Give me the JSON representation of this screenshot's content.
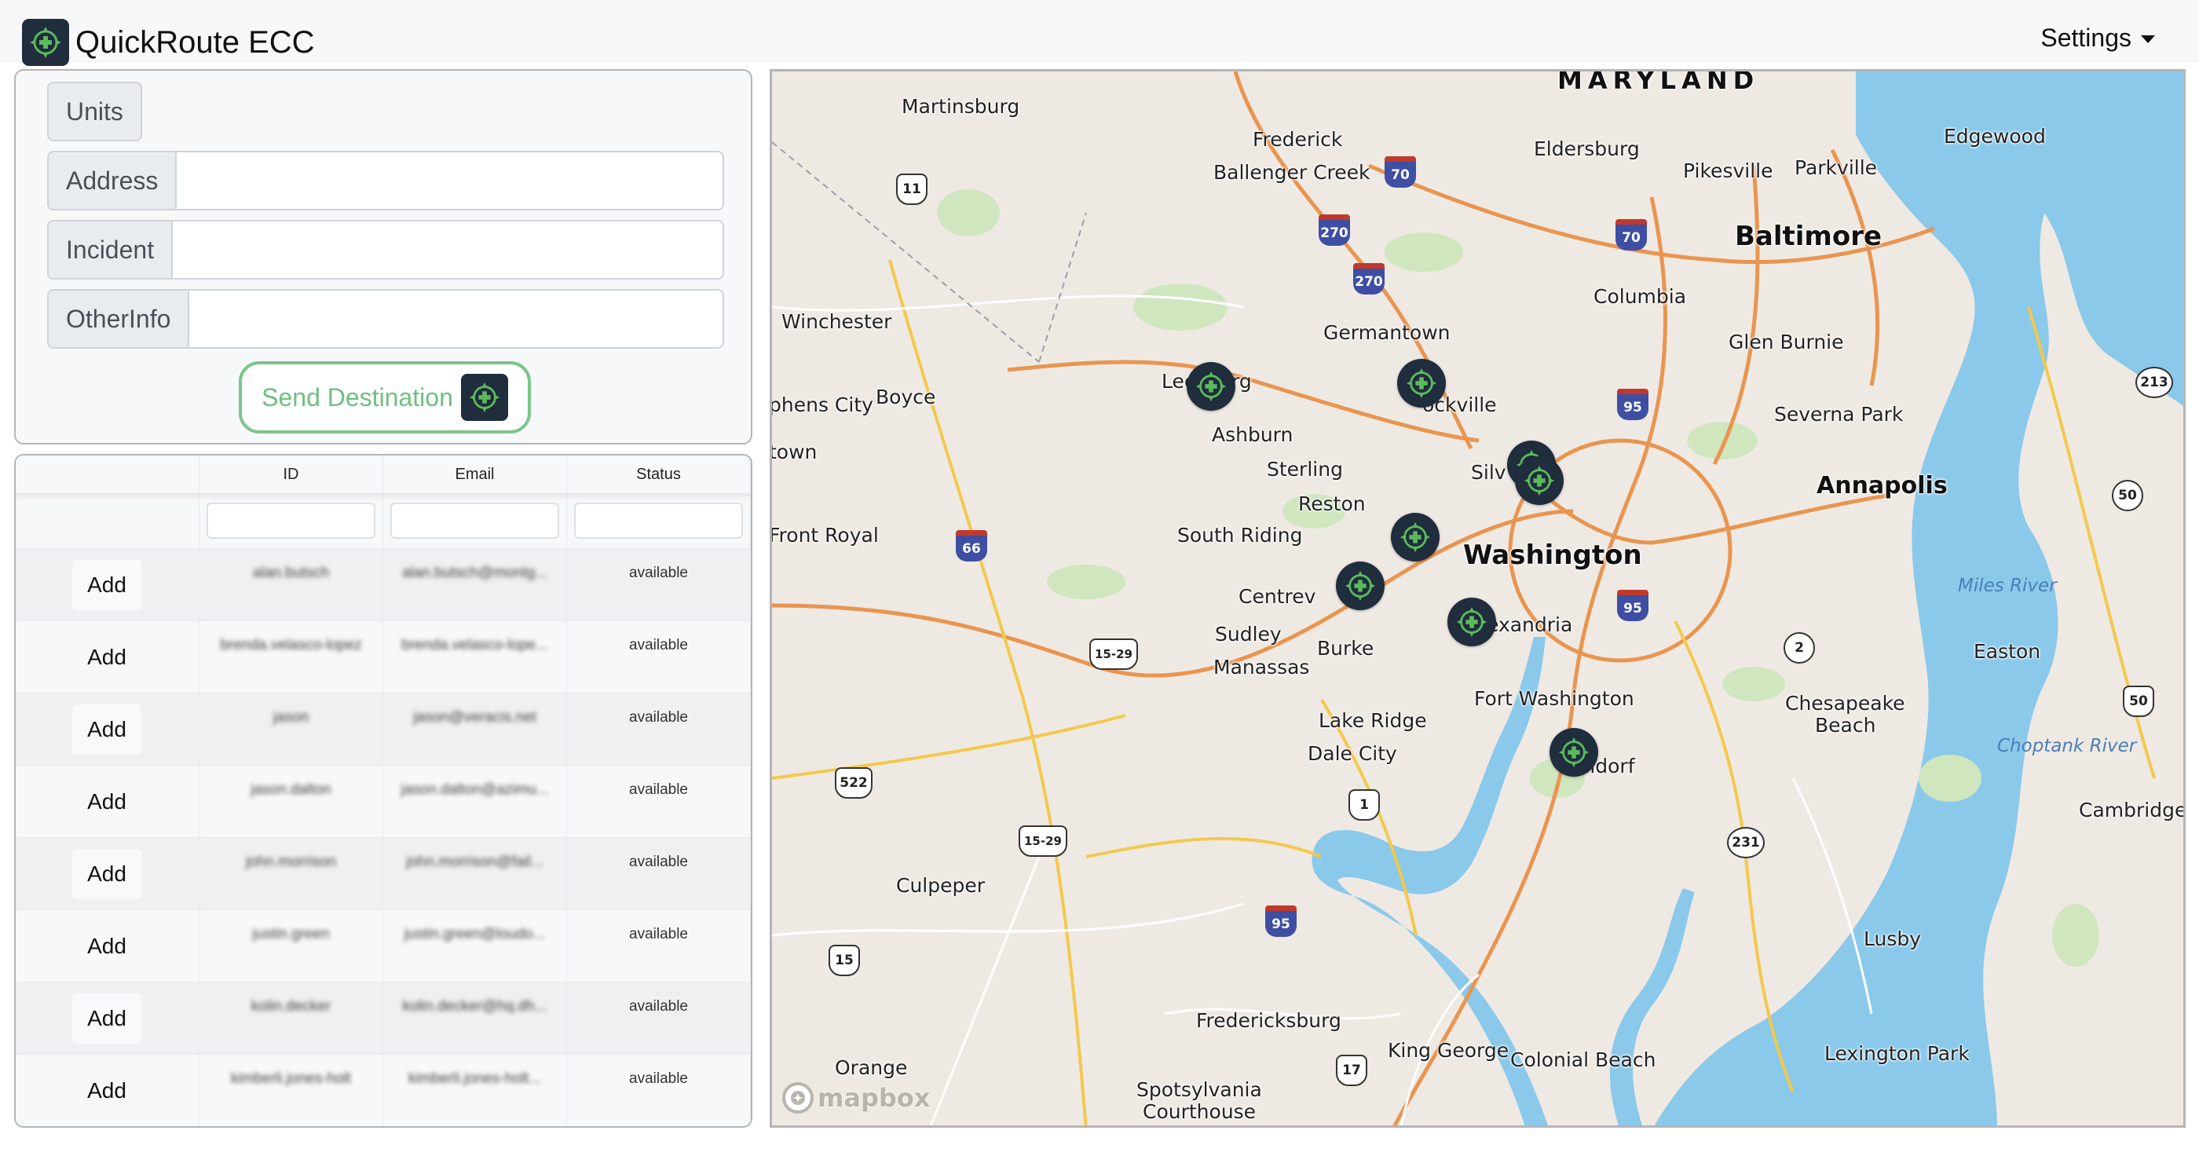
{
  "header": {
    "title": "QuickRoute ECC",
    "settings_label": "Settings"
  },
  "form": {
    "units_label": "Units",
    "address_label": "Address",
    "address_value": "",
    "incident_label": "Incident",
    "incident_value": "",
    "otherinfo_label": "OtherInfo",
    "otherinfo_value": "",
    "send_button_label": "Send Destination"
  },
  "table": {
    "columns": [
      "",
      "ID",
      "Email",
      "Status"
    ],
    "add_label": "Add",
    "rows": [
      {
        "id": "alan.butsch",
        "email": "alan.butsch@montg...",
        "status": "available"
      },
      {
        "id": "brenda.velasco-lopez",
        "email": "brenda.velasco-lope...",
        "status": "available"
      },
      {
        "id": "jason",
        "email": "jason@veracis.net",
        "status": "available"
      },
      {
        "id": "jason.dalton",
        "email": "jason.dalton@azimu...",
        "status": "available"
      },
      {
        "id": "john.morrison",
        "email": "john.morrison@fail...",
        "status": "available"
      },
      {
        "id": "justin.green",
        "email": "justin.green@loudo...",
        "status": "available"
      },
      {
        "id": "kolin.decker",
        "email": "kolin.decker@hq.dh...",
        "status": "available"
      },
      {
        "id": "kimberli.jones-holt",
        "email": "kimberli.jones-holt...",
        "status": "available"
      }
    ]
  },
  "map": {
    "attribution": "mapbox",
    "colors": {
      "land": "#efe9e3",
      "water": "#8ac9ea",
      "park": "#cfe6bf",
      "highway": "#e9954f",
      "road": "#f2c94c",
      "marker": "#1f2d3d",
      "marker_icon": "#5cb85c"
    },
    "labels": {
      "state": "MARYLAND",
      "baltimore": "Baltimore",
      "washington": "Washington",
      "annapolis": "Annapolis",
      "martinsburg": "Martinsburg",
      "frederick": "Frederick",
      "ballenger": "Ballenger Creek",
      "eldersburg": "Eldersburg",
      "pikesville": "Pikesville",
      "parkville": "Parkville",
      "edgewood": "Edgewood",
      "columbia": "Columbia",
      "glenburnie": "Glen Burnie",
      "winchester": "Winchester",
      "germantown": "Germantown",
      "leesburg": "Leesburg",
      "rockville": "ockville",
      "stephens": "phens City",
      "boyce": "Boyce",
      "ashburn": "Ashburn",
      "severna": "Severna Park",
      "town": "town",
      "sterling": "Sterling",
      "silverspring": "Silv     ring",
      "reston": "Reston",
      "frontroyal": "Front Royal",
      "southriding": "South Riding",
      "milesriver": "Miles River",
      "centrev": "Centrev",
      "alexandria": "exandria",
      "sudley": "Sudley",
      "burke": "Burke",
      "easton": "Easton",
      "manassas": "Manassas",
      "fortwash": "Fort Washington",
      "chesapeake": "Chesapeake",
      "beach": "Beach",
      "lakeridge": "Lake Ridge",
      "choptank": "Choptank River",
      "dalecity": "Dale City",
      "waldorf": "aldorf",
      "cambridge": "Cambridge",
      "culpeper": "Culpeper",
      "lusby": "Lusby",
      "fredericksburg": "Fredericksburg",
      "kinggeorge": "King George",
      "colonialbeach": "Colonial Beach",
      "lexingtonpark": "Lexington Park",
      "orange": "Orange",
      "spotsylvania": "Spotsylvania",
      "courthouse": "Courthouse"
    },
    "shields": [
      {
        "type": "us",
        "num": "11"
      },
      {
        "type": "interstate",
        "num": "70"
      },
      {
        "type": "interstate",
        "num": "270"
      },
      {
        "type": "interstate",
        "num": "70"
      },
      {
        "type": "interstate",
        "num": "270"
      },
      {
        "type": "interstate",
        "num": "95"
      },
      {
        "type": "state-route",
        "num": "213"
      },
      {
        "type": "interstate",
        "num": "66"
      },
      {
        "type": "state-route",
        "num": "50"
      },
      {
        "type": "interstate",
        "num": "95"
      },
      {
        "type": "us",
        "num": "15-29"
      },
      {
        "type": "state-route",
        "num": "2"
      },
      {
        "type": "us",
        "num": "50"
      },
      {
        "type": "us",
        "num": "522"
      },
      {
        "type": "us",
        "num": "1"
      },
      {
        "type": "us",
        "num": "15-29"
      },
      {
        "type": "state-route",
        "num": "231"
      },
      {
        "type": "interstate",
        "num": "95"
      },
      {
        "type": "us",
        "num": "15"
      },
      {
        "type": "us",
        "num": "17"
      }
    ],
    "markers": [
      "unit-1",
      "unit-2",
      "unit-3",
      "unit-4",
      "unit-5",
      "unit-6",
      "unit-7",
      "unit-8"
    ]
  }
}
